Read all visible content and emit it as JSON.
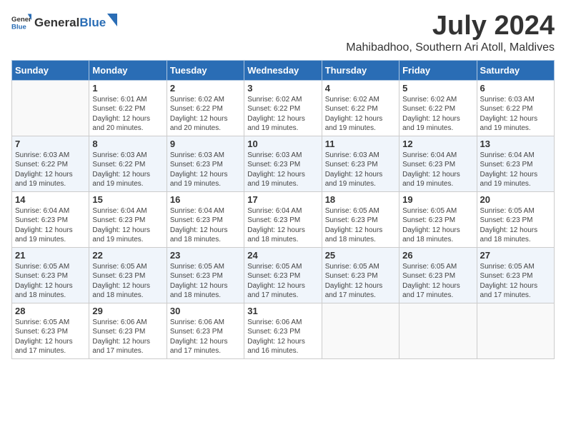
{
  "header": {
    "logo_general": "General",
    "logo_blue": "Blue",
    "month": "July 2024",
    "location": "Mahibadhoo, Southern Ari Atoll, Maldives"
  },
  "weekdays": [
    "Sunday",
    "Monday",
    "Tuesday",
    "Wednesday",
    "Thursday",
    "Friday",
    "Saturday"
  ],
  "weeks": [
    [
      {
        "day": "",
        "sunrise": "",
        "sunset": "",
        "daylight": ""
      },
      {
        "day": "1",
        "sunrise": "6:01 AM",
        "sunset": "6:22 PM",
        "daylight": "12 hours and 20 minutes."
      },
      {
        "day": "2",
        "sunrise": "6:02 AM",
        "sunset": "6:22 PM",
        "daylight": "12 hours and 20 minutes."
      },
      {
        "day": "3",
        "sunrise": "6:02 AM",
        "sunset": "6:22 PM",
        "daylight": "12 hours and 19 minutes."
      },
      {
        "day": "4",
        "sunrise": "6:02 AM",
        "sunset": "6:22 PM",
        "daylight": "12 hours and 19 minutes."
      },
      {
        "day": "5",
        "sunrise": "6:02 AM",
        "sunset": "6:22 PM",
        "daylight": "12 hours and 19 minutes."
      },
      {
        "day": "6",
        "sunrise": "6:03 AM",
        "sunset": "6:22 PM",
        "daylight": "12 hours and 19 minutes."
      }
    ],
    [
      {
        "day": "7",
        "sunrise": "6:03 AM",
        "sunset": "6:22 PM",
        "daylight": "12 hours and 19 minutes."
      },
      {
        "day": "8",
        "sunrise": "6:03 AM",
        "sunset": "6:22 PM",
        "daylight": "12 hours and 19 minutes."
      },
      {
        "day": "9",
        "sunrise": "6:03 AM",
        "sunset": "6:23 PM",
        "daylight": "12 hours and 19 minutes."
      },
      {
        "day": "10",
        "sunrise": "6:03 AM",
        "sunset": "6:23 PM",
        "daylight": "12 hours and 19 minutes."
      },
      {
        "day": "11",
        "sunrise": "6:03 AM",
        "sunset": "6:23 PM",
        "daylight": "12 hours and 19 minutes."
      },
      {
        "day": "12",
        "sunrise": "6:04 AM",
        "sunset": "6:23 PM",
        "daylight": "12 hours and 19 minutes."
      },
      {
        "day": "13",
        "sunrise": "6:04 AM",
        "sunset": "6:23 PM",
        "daylight": "12 hours and 19 minutes."
      }
    ],
    [
      {
        "day": "14",
        "sunrise": "6:04 AM",
        "sunset": "6:23 PM",
        "daylight": "12 hours and 19 minutes."
      },
      {
        "day": "15",
        "sunrise": "6:04 AM",
        "sunset": "6:23 PM",
        "daylight": "12 hours and 19 minutes."
      },
      {
        "day": "16",
        "sunrise": "6:04 AM",
        "sunset": "6:23 PM",
        "daylight": "12 hours and 18 minutes."
      },
      {
        "day": "17",
        "sunrise": "6:04 AM",
        "sunset": "6:23 PM",
        "daylight": "12 hours and 18 minutes."
      },
      {
        "day": "18",
        "sunrise": "6:05 AM",
        "sunset": "6:23 PM",
        "daylight": "12 hours and 18 minutes."
      },
      {
        "day": "19",
        "sunrise": "6:05 AM",
        "sunset": "6:23 PM",
        "daylight": "12 hours and 18 minutes."
      },
      {
        "day": "20",
        "sunrise": "6:05 AM",
        "sunset": "6:23 PM",
        "daylight": "12 hours and 18 minutes."
      }
    ],
    [
      {
        "day": "21",
        "sunrise": "6:05 AM",
        "sunset": "6:23 PM",
        "daylight": "12 hours and 18 minutes."
      },
      {
        "day": "22",
        "sunrise": "6:05 AM",
        "sunset": "6:23 PM",
        "daylight": "12 hours and 18 minutes."
      },
      {
        "day": "23",
        "sunrise": "6:05 AM",
        "sunset": "6:23 PM",
        "daylight": "12 hours and 18 minutes."
      },
      {
        "day": "24",
        "sunrise": "6:05 AM",
        "sunset": "6:23 PM",
        "daylight": "12 hours and 17 minutes."
      },
      {
        "day": "25",
        "sunrise": "6:05 AM",
        "sunset": "6:23 PM",
        "daylight": "12 hours and 17 minutes."
      },
      {
        "day": "26",
        "sunrise": "6:05 AM",
        "sunset": "6:23 PM",
        "daylight": "12 hours and 17 minutes."
      },
      {
        "day": "27",
        "sunrise": "6:05 AM",
        "sunset": "6:23 PM",
        "daylight": "12 hours and 17 minutes."
      }
    ],
    [
      {
        "day": "28",
        "sunrise": "6:05 AM",
        "sunset": "6:23 PM",
        "daylight": "12 hours and 17 minutes."
      },
      {
        "day": "29",
        "sunrise": "6:06 AM",
        "sunset": "6:23 PM",
        "daylight": "12 hours and 17 minutes."
      },
      {
        "day": "30",
        "sunrise": "6:06 AM",
        "sunset": "6:23 PM",
        "daylight": "12 hours and 17 minutes."
      },
      {
        "day": "31",
        "sunrise": "6:06 AM",
        "sunset": "6:23 PM",
        "daylight": "12 hours and 16 minutes."
      },
      {
        "day": "",
        "sunrise": "",
        "sunset": "",
        "daylight": ""
      },
      {
        "day": "",
        "sunrise": "",
        "sunset": "",
        "daylight": ""
      },
      {
        "day": "",
        "sunrise": "",
        "sunset": "",
        "daylight": ""
      }
    ]
  ]
}
